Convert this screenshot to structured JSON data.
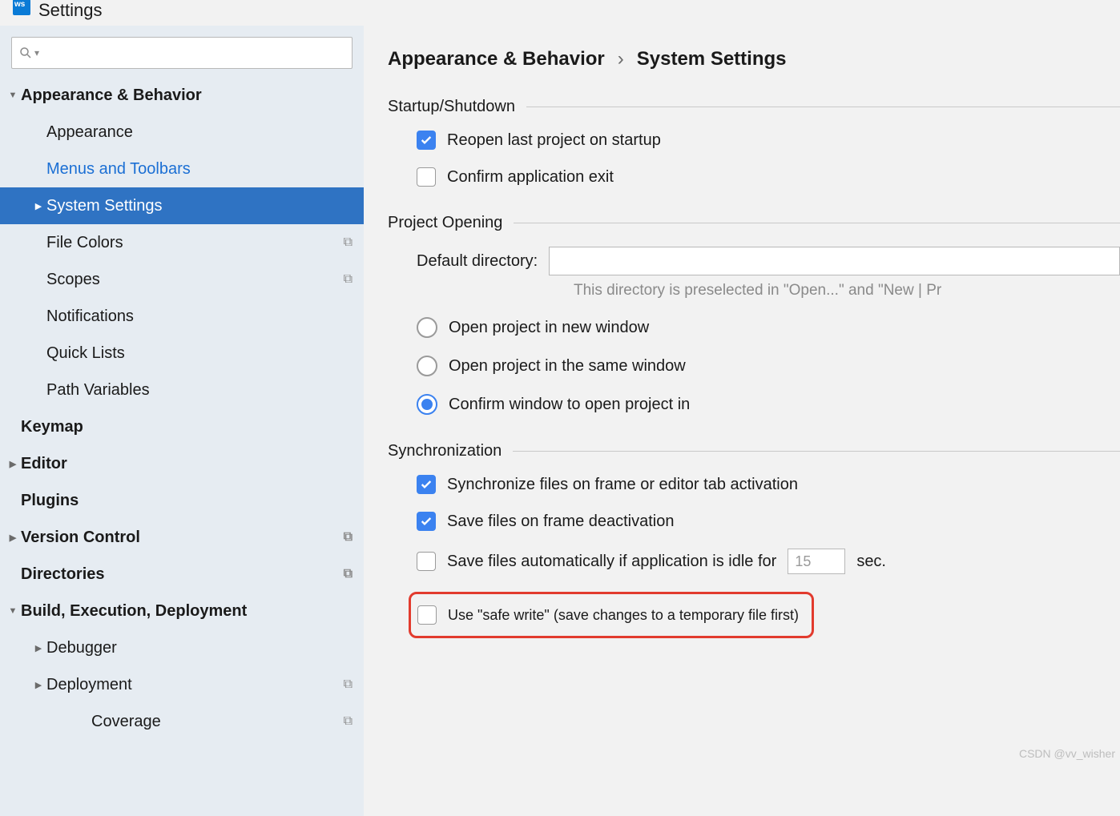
{
  "title": "Settings",
  "breadcrumb": {
    "parent": "Appearance & Behavior",
    "sep": "›",
    "current": "System Settings"
  },
  "sidebar": {
    "search_placeholder": "",
    "items": [
      {
        "label": "Appearance & Behavior",
        "level": 0,
        "arrow": "down",
        "bold": true
      },
      {
        "label": "Appearance",
        "level": 1
      },
      {
        "label": "Menus and Toolbars",
        "level": 1,
        "link": true
      },
      {
        "label": "System Settings",
        "level": 1,
        "arrow": "right",
        "selected": true
      },
      {
        "label": "File Colors",
        "level": 1,
        "dup": true
      },
      {
        "label": "Scopes",
        "level": 1,
        "dup": true
      },
      {
        "label": "Notifications",
        "level": 1
      },
      {
        "label": "Quick Lists",
        "level": 1
      },
      {
        "label": "Path Variables",
        "level": 1
      },
      {
        "label": "Keymap",
        "level": 0,
        "bold": true
      },
      {
        "label": "Editor",
        "level": 0,
        "arrow": "right",
        "bold": true
      },
      {
        "label": "Plugins",
        "level": 0,
        "bold": true
      },
      {
        "label": "Version Control",
        "level": 0,
        "arrow": "right",
        "bold": true,
        "dup": true
      },
      {
        "label": "Directories",
        "level": 0,
        "bold": true,
        "dup": true
      },
      {
        "label": "Build, Execution, Deployment",
        "level": 0,
        "arrow": "down",
        "bold": true
      },
      {
        "label": "Debugger",
        "level": 1,
        "arrow": "right"
      },
      {
        "label": "Deployment",
        "level": 1,
        "arrow": "right",
        "dup": true
      },
      {
        "label": "Coverage",
        "level": 2,
        "dup": true
      }
    ]
  },
  "sections": {
    "startup": {
      "title": "Startup/Shutdown",
      "reopen": {
        "label": "Reopen last project on startup",
        "checked": true
      },
      "confirm_exit": {
        "label": "Confirm application exit",
        "checked": false
      }
    },
    "project_opening": {
      "title": "Project Opening",
      "default_dir_label": "Default directory:",
      "default_dir_value": "",
      "hint": "This directory is preselected in \"Open...\" and \"New | Pr",
      "radios": {
        "new_window": "Open project in new window",
        "same_window": "Open project in the same window",
        "confirm": "Confirm window to open project in",
        "selected": "confirm"
      }
    },
    "sync": {
      "title": "Synchronization",
      "sync_frame": {
        "label": "Synchronize files on frame or editor tab activation",
        "checked": true
      },
      "save_deact": {
        "label": "Save files on frame deactivation",
        "checked": true
      },
      "save_idle": {
        "prefix": "Save files automatically if application is idle for",
        "value": "15",
        "suffix": "sec.",
        "checked": false
      },
      "safe_write": {
        "label": "Use \"safe write\" (save changes to a temporary file first)",
        "checked": false
      }
    }
  },
  "watermark": "CSDN @vv_wisher"
}
